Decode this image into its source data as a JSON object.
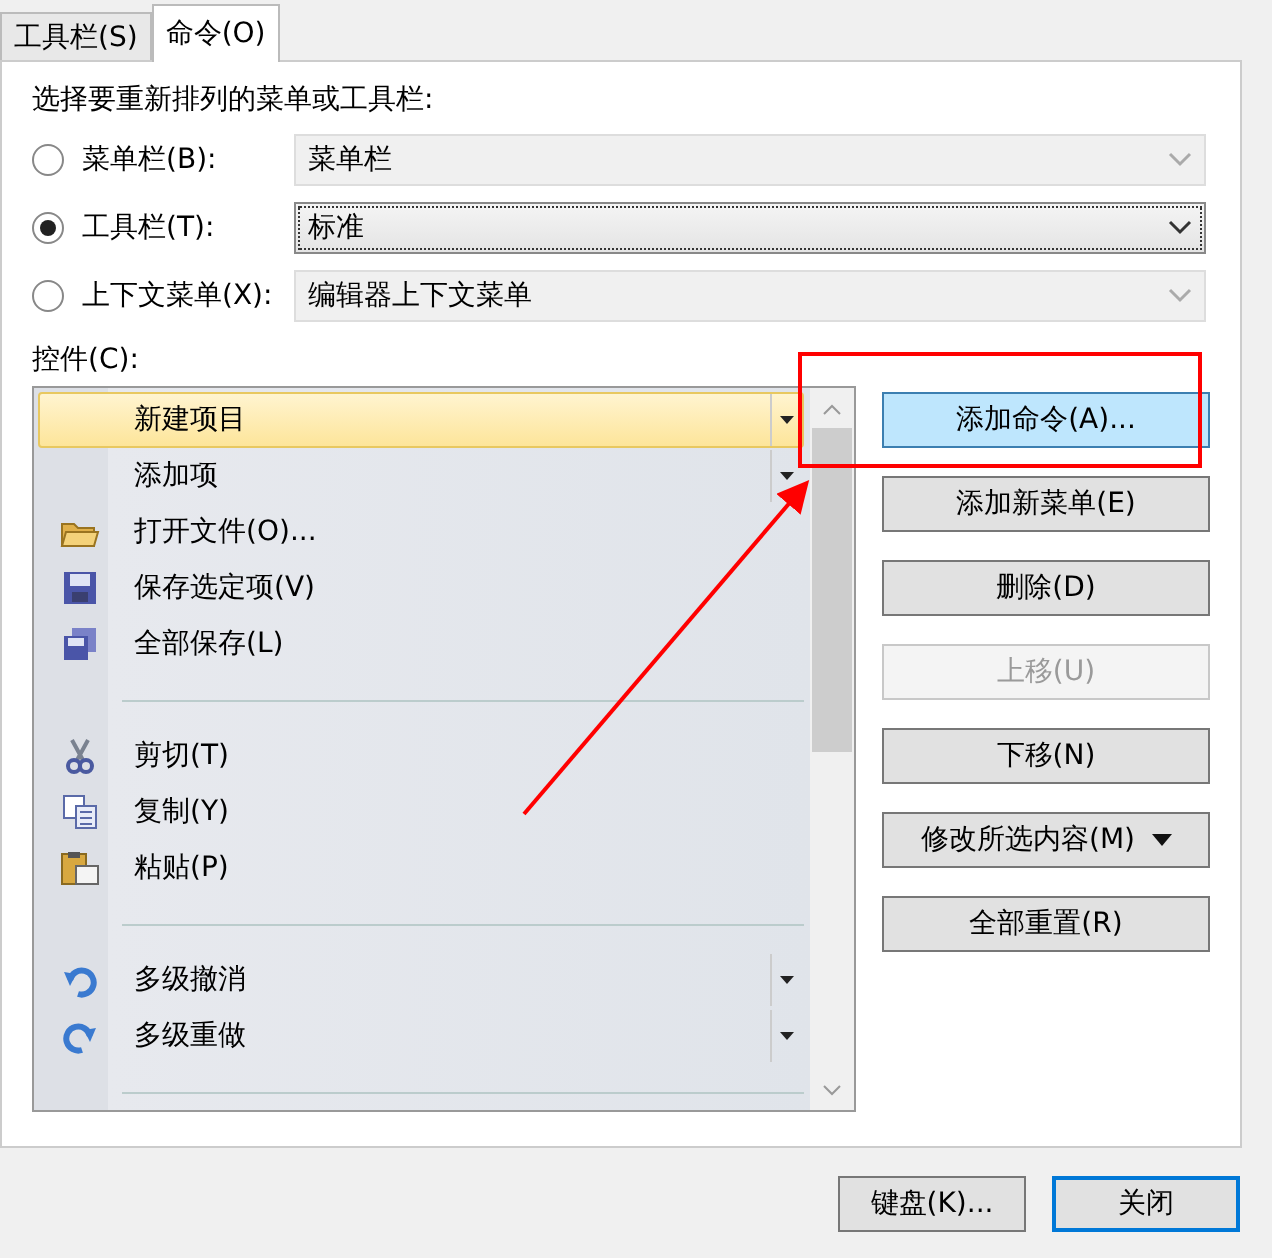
{
  "tabs": [
    {
      "label": "工具栏(S)",
      "selected": false
    },
    {
      "label": "命令(O)",
      "selected": true
    }
  ],
  "prompt": "选择要重新排列的菜单或工具栏:",
  "targets": [
    {
      "label": "菜单栏(B):",
      "selected": false,
      "value": "菜单栏",
      "disabled": true
    },
    {
      "label": "工具栏(T):",
      "selected": true,
      "value": "标准",
      "disabled": false
    },
    {
      "label": "上下文菜单(X):",
      "selected": false,
      "value": "编辑器上下文菜单",
      "disabled": true
    }
  ],
  "controls_label": "控件(C):",
  "controls": [
    {
      "kind": "command",
      "label": "新建项目",
      "selected": true,
      "dropdown": true
    },
    {
      "kind": "command",
      "label": "添加项",
      "selected": false,
      "dropdown": true
    },
    {
      "kind": "command",
      "label": "打开文件(O)...",
      "selected": false,
      "dropdown": false
    },
    {
      "kind": "command",
      "label": "保存选定项(V)",
      "selected": false,
      "dropdown": false
    },
    {
      "kind": "command",
      "label": "全部保存(L)",
      "selected": false,
      "dropdown": false
    },
    {
      "kind": "separator"
    },
    {
      "kind": "command",
      "label": "剪切(T)",
      "selected": false,
      "dropdown": false
    },
    {
      "kind": "command",
      "label": "复制(Y)",
      "selected": false,
      "dropdown": false
    },
    {
      "kind": "command",
      "label": "粘贴(P)",
      "selected": false,
      "dropdown": false
    },
    {
      "kind": "separator"
    },
    {
      "kind": "command",
      "label": "多级撤消",
      "selected": false,
      "dropdown": true
    },
    {
      "kind": "command",
      "label": "多级重做",
      "selected": false,
      "dropdown": true
    },
    {
      "kind": "separator"
    }
  ],
  "actions": [
    {
      "label": "添加命令(A)...",
      "disabled": false,
      "hovered": true,
      "menu": false
    },
    {
      "label": "添加新菜单(E)",
      "disabled": false,
      "hovered": false,
      "menu": false
    },
    {
      "label": "删除(D)",
      "disabled": false,
      "hovered": false,
      "menu": false
    },
    {
      "label": "上移(U)",
      "disabled": true,
      "hovered": false,
      "menu": false
    },
    {
      "label": "下移(N)",
      "disabled": false,
      "hovered": false,
      "menu": false
    },
    {
      "label": "修改所选内容(M)",
      "disabled": false,
      "hovered": false,
      "menu": true
    },
    {
      "label": "全部重置(R)",
      "disabled": false,
      "hovered": false,
      "menu": false
    }
  ],
  "footer_buttons": [
    {
      "label": "键盘(K)...",
      "default": false
    },
    {
      "label": "关闭",
      "default": true
    }
  ]
}
